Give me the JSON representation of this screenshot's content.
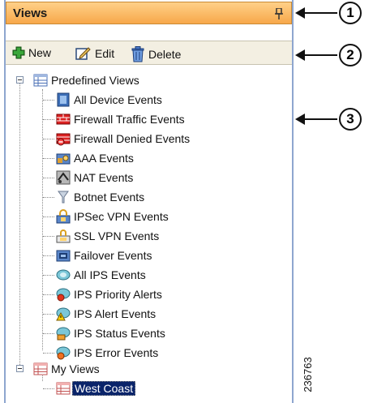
{
  "panel": {
    "title": "Views",
    "toolbar": {
      "new_label": "New",
      "edit_label": "Edit",
      "delete_label": "Delete"
    }
  },
  "tree": {
    "predefined": {
      "label": "Predefined Views",
      "items": [
        {
          "label": "All Device Events",
          "icon": "device-events-icon"
        },
        {
          "label": "Firewall Traffic Events",
          "icon": "firewall-traffic-icon"
        },
        {
          "label": "Firewall Denied Events",
          "icon": "firewall-denied-icon"
        },
        {
          "label": "AAA Events",
          "icon": "aaa-icon"
        },
        {
          "label": "NAT Events",
          "icon": "nat-icon"
        },
        {
          "label": "Botnet Events",
          "icon": "botnet-icon"
        },
        {
          "label": "IPSec VPN Events",
          "icon": "ipsec-vpn-icon"
        },
        {
          "label": "SSL VPN Events",
          "icon": "ssl-vpn-icon"
        },
        {
          "label": "Failover Events",
          "icon": "failover-icon"
        },
        {
          "label": "All IPS Events",
          "icon": "ips-icon"
        },
        {
          "label": "IPS Priority Alerts",
          "icon": "ips-priority-icon"
        },
        {
          "label": "IPS Alert Events",
          "icon": "ips-alert-icon"
        },
        {
          "label": "IPS Status Events",
          "icon": "ips-status-icon"
        },
        {
          "label": "IPS Error Events",
          "icon": "ips-error-icon"
        }
      ]
    },
    "my_views": {
      "label": "My Views",
      "items": [
        {
          "label": "West Coast",
          "selected": true
        }
      ]
    }
  },
  "callouts": [
    "1",
    "2",
    "3"
  ],
  "figure_id": "236763",
  "colors": {
    "title_bar": "#f7a84a",
    "selection": "#0a246a",
    "panel_border": "#8ea6cf"
  }
}
